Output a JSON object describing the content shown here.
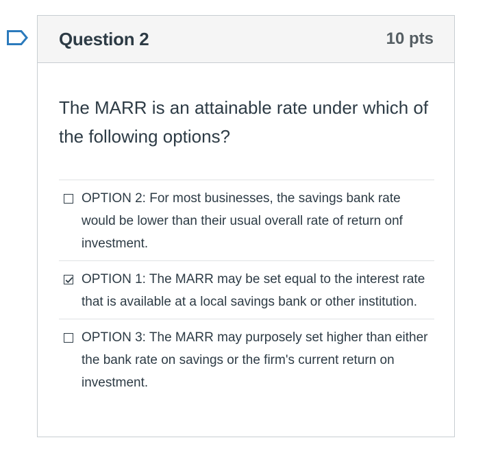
{
  "question": {
    "name": "Question 2",
    "points": "10 pts",
    "text": "The MARR is an attainable rate under which of the following options?"
  },
  "answers": [
    {
      "label": "OPTION 2: For most businesses, the savings bank rate would be lower than their usual overall rate of return onf investment.",
      "checked": false
    },
    {
      "label": "OPTION 1: The MARR may be set equal to the interest rate that is available at a local savings bank or other institution.",
      "checked": true
    },
    {
      "label": "OPTION 3: The MARR may purposely set higher than either the bank rate on savings or the firm's current return on investment.",
      "checked": false
    }
  ],
  "colors": {
    "flag": "#2b7abc",
    "text": "#2d3b45",
    "points": "#555e63",
    "header_bg": "#f5f5f5",
    "border": "#c7cdd1"
  },
  "icons": {
    "flag": "flag-question-icon",
    "checkbox": "checkbox-icon",
    "checkmark": "checkmark-icon"
  }
}
